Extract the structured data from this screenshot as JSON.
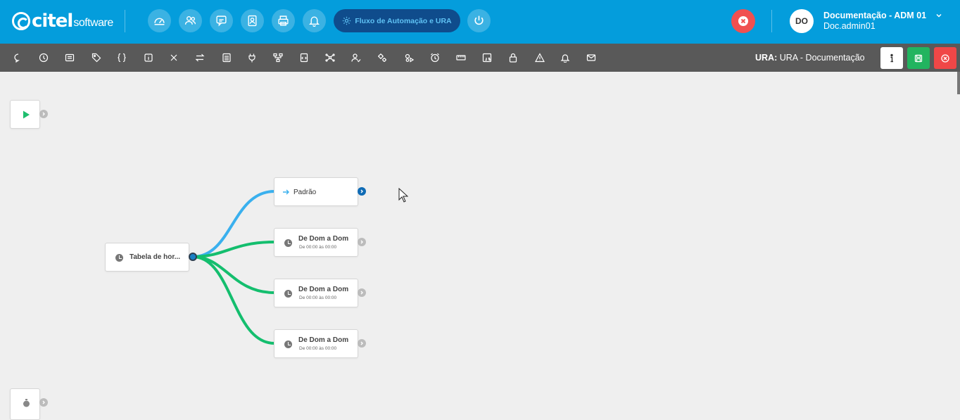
{
  "brand": {
    "name": "citel",
    "sub": "software"
  },
  "nav": {
    "buttons": [
      {
        "icon": "dashboard-icon"
      },
      {
        "icon": "users-icon"
      },
      {
        "icon": "chat-icon"
      },
      {
        "icon": "contact-icon"
      },
      {
        "icon": "printer-icon"
      },
      {
        "icon": "bell-icon"
      }
    ],
    "flow_button_label": "Fluxo de Automação e URA",
    "power_icon": "power-icon"
  },
  "user": {
    "initials": "DO",
    "name": "Documentação - ADM 01",
    "login": "Doc.admin01"
  },
  "toolbar": {
    "tools": [
      "message-icon",
      "clock-icon",
      "list-icon",
      "tag-icon",
      "braces-icon",
      "info-icon",
      "close-icon",
      "transfer-icon",
      "queue-icon",
      "plug-icon",
      "hierarchy-icon",
      "file-code-icon",
      "network-icon",
      "user-check-icon",
      "gears-icon",
      "gears-play-icon",
      "alarm-icon",
      "ruler-icon",
      "js-icon",
      "lock-icon",
      "warning-icon",
      "bell-icon",
      "mail-icon"
    ],
    "ura_prefix": "URA:",
    "ura_name": "URA - Documentação",
    "colors": {
      "info": "#ffffff",
      "save": "#22b45f",
      "close": "#f04747"
    }
  },
  "flow": {
    "start_icon": "play-icon",
    "end_icon": "timer-icon",
    "source_node": {
      "label": "Tabela de hor...",
      "icon": "clock-icon"
    },
    "branches": [
      {
        "title": "Padrão",
        "icon": "arrow-right-icon",
        "subtitle": "",
        "color": "#3ab0ee"
      },
      {
        "title": "De Dom a Dom",
        "icon": "clock-icon",
        "subtitle": "De 00:00 às 00:00",
        "color": "#14be6e"
      },
      {
        "title": "De Dom a Dom",
        "icon": "clock-icon",
        "subtitle": "De 00:00 às 00:00",
        "color": "#14be6e"
      },
      {
        "title": "De Dom a Dom",
        "icon": "clock-icon",
        "subtitle": "De 00:00 às 00:00",
        "color": "#14be6e"
      }
    ]
  },
  "colors": {
    "header": "#049ddc",
    "toolbar": "#595959",
    "canvas": "#efefef",
    "flow_button": "#0f4c8c"
  }
}
